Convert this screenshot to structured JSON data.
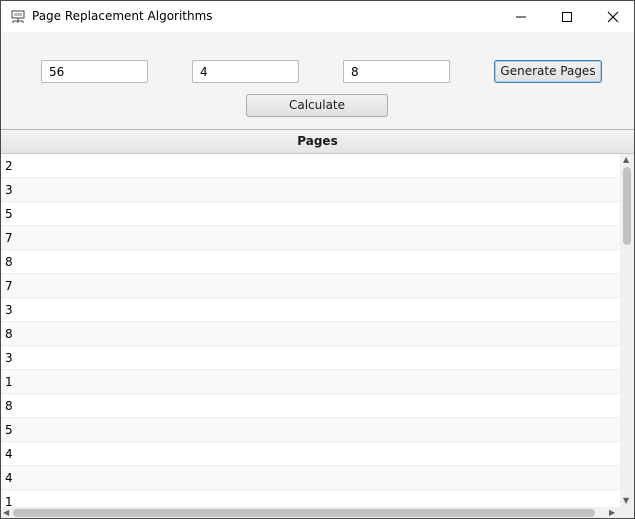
{
  "window": {
    "title": "Page Replacement Algorithms",
    "icon": "network-printer-icon",
    "controls": [
      "minimize",
      "maximize",
      "close"
    ]
  },
  "inputs": {
    "field1": "56",
    "field2": "4",
    "field3": "8"
  },
  "buttons": {
    "generate_label": "Generate Pages",
    "calculate_label": "Calculate"
  },
  "table": {
    "header": "Pages",
    "rows": [
      "2",
      "3",
      "5",
      "7",
      "8",
      "7",
      "3",
      "8",
      "3",
      "1",
      "8",
      "5",
      "4",
      "4",
      "1"
    ]
  },
  "colors": {
    "focus_border": "#3c7fb1",
    "window_bg": "#f4f4f4"
  }
}
